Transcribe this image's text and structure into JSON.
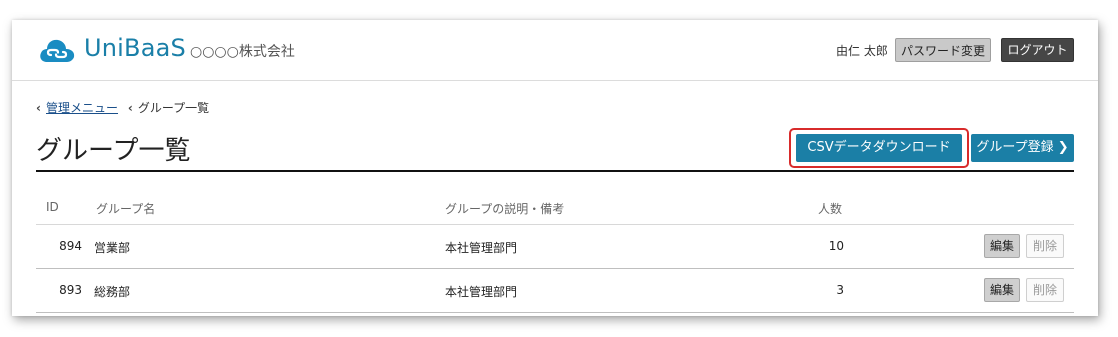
{
  "header": {
    "brand": "UniBaaS",
    "company": "○○○○株式会社",
    "user_name": "由仁 太郎",
    "password_button": "パスワード変更",
    "logout_button": "ログアウト"
  },
  "breadcrumb": {
    "items": [
      {
        "label": "管理メニュー",
        "link": true
      },
      {
        "label": "グループ一覧",
        "link": false
      }
    ]
  },
  "page": {
    "title": "グループ一覧",
    "csv_button": "CSVデータダウンロード",
    "add_button": "グループ登録 ❯"
  },
  "table": {
    "headers": [
      "ID",
      "グループ名",
      "グループの説明・備考",
      "人数"
    ],
    "rows": [
      {
        "id": "894",
        "name": "営業部",
        "desc": "本社管理部門",
        "count": "10",
        "edit": "編集",
        "delete": "削除"
      },
      {
        "id": "893",
        "name": "総務部",
        "desc": "本社管理部門",
        "count": "3",
        "edit": "編集",
        "delete": "削除"
      }
    ]
  },
  "colors": {
    "brand": "#1a7fa8",
    "primary_button": "#1b7fa6",
    "highlight": "#d82b2b",
    "logout_button": "#464646"
  },
  "icons": [
    "cloud-link-logo-icon",
    "chevron-left-icon",
    "chevron-right-icon"
  ]
}
